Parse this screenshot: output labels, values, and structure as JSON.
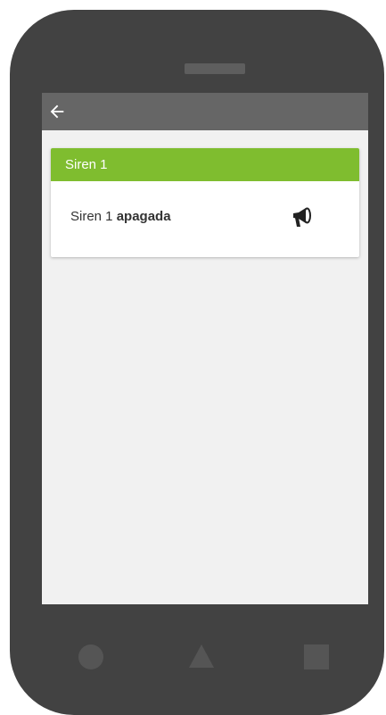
{
  "app_bar": {
    "back_icon": "arrow-left-icon"
  },
  "card": {
    "title": "Siren 1",
    "device_name": "Siren 1",
    "state": "apagada",
    "icon": "megaphone-icon",
    "header_color": "#7fbd2f"
  },
  "nav_bar": {
    "buttons": [
      "back-circle",
      "home-triangle",
      "recents-square"
    ]
  }
}
